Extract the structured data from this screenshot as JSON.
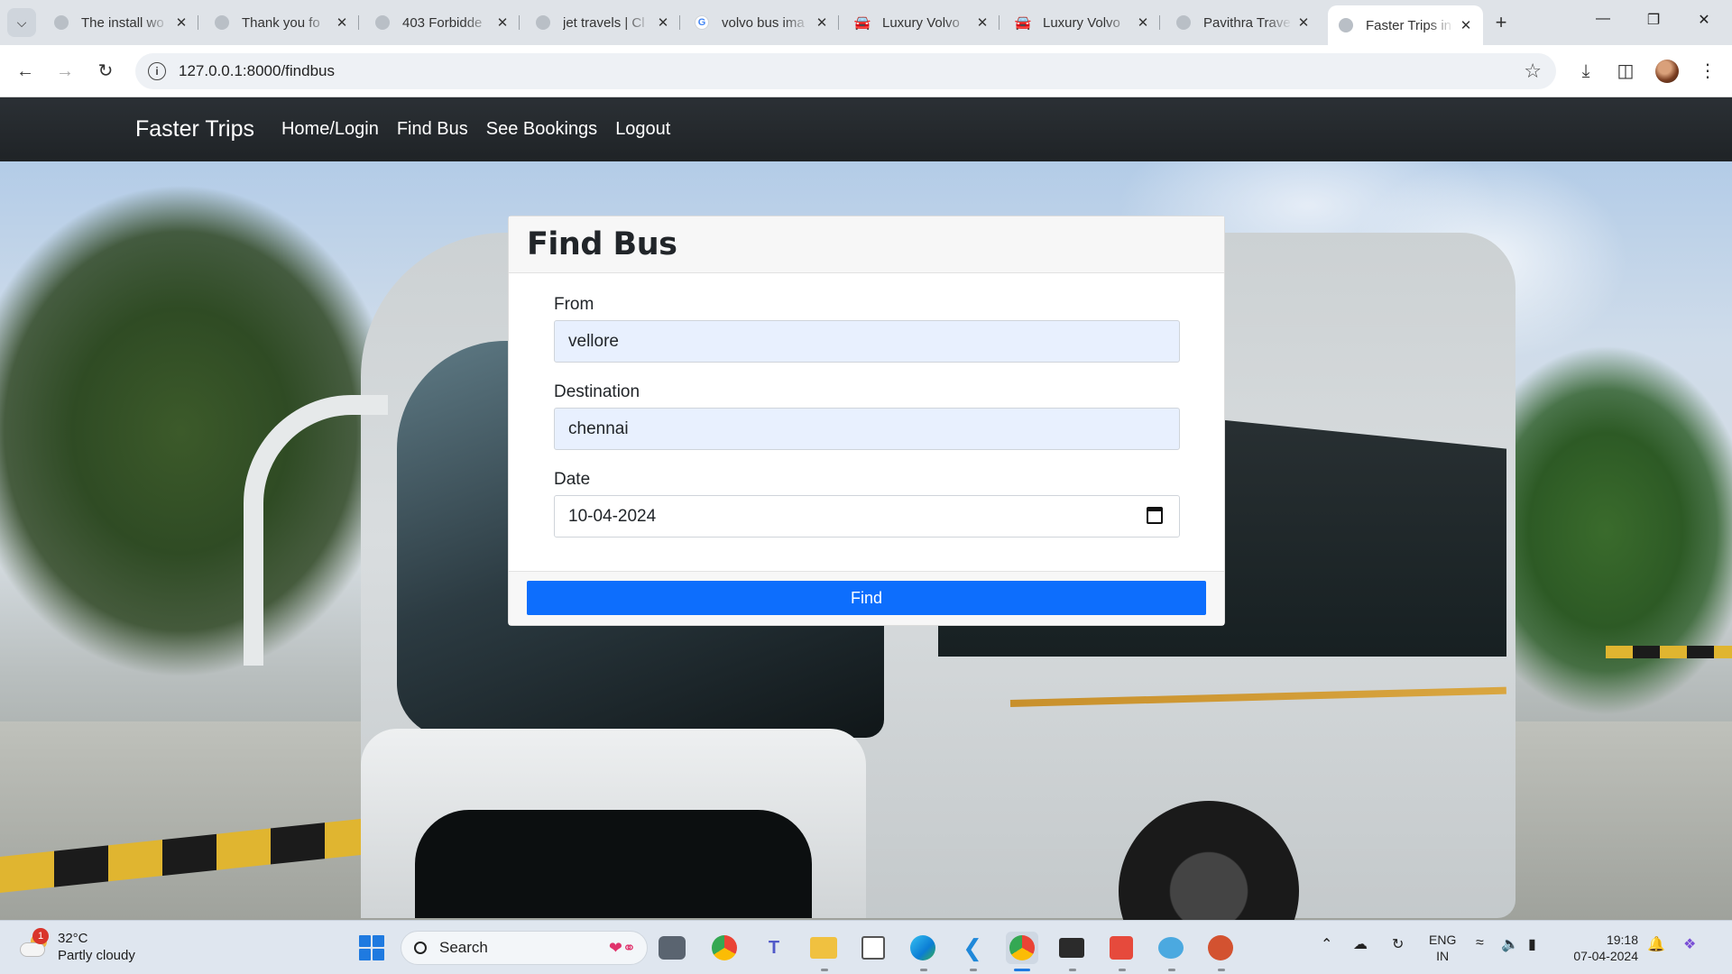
{
  "browser": {
    "tabs": [
      {
        "title": "The install wo",
        "icon": "globe-icon",
        "active": false
      },
      {
        "title": "Thank you fo",
        "icon": "globe-icon",
        "active": false
      },
      {
        "title": "403 Forbidde",
        "icon": "globe-icon",
        "active": false
      },
      {
        "title": "jet travels | Cl",
        "icon": "globe-icon",
        "active": false
      },
      {
        "title": "volvo bus ima",
        "icon": "google-icon",
        "active": false
      },
      {
        "title": "Luxury Volvo",
        "icon": "car-icon",
        "active": false
      },
      {
        "title": "Luxury Volvo",
        "icon": "car-icon",
        "active": false
      },
      {
        "title": "Pavithra Trave",
        "icon": "globe-icon",
        "active": false
      },
      {
        "title": "Faster Trips in",
        "icon": "globe-icon",
        "active": true
      }
    ],
    "url": "127.0.0.1:8000/findbus"
  },
  "site": {
    "brand": "Faster Trips",
    "nav": [
      "Home/Login",
      "Find Bus",
      "See Bookings",
      "Logout"
    ]
  },
  "form": {
    "title": "Find Bus",
    "from_label": "From",
    "from_value": "vellore",
    "destination_label": "Destination",
    "destination_value": "chennai",
    "date_label": "Date",
    "date_value": "10-04-2024",
    "submit_label": "Find"
  },
  "taskbar": {
    "weather_temp": "32°C",
    "weather_desc": "Partly cloudy",
    "weather_badge": "1",
    "search_label": "Search",
    "lang_top": "ENG",
    "lang_bottom": "IN",
    "time": "19:18",
    "date": "07-04-2024"
  },
  "colors": {
    "primary": "#0d6efd",
    "navbar": "#212529",
    "autofill": "#e8f0fe"
  }
}
